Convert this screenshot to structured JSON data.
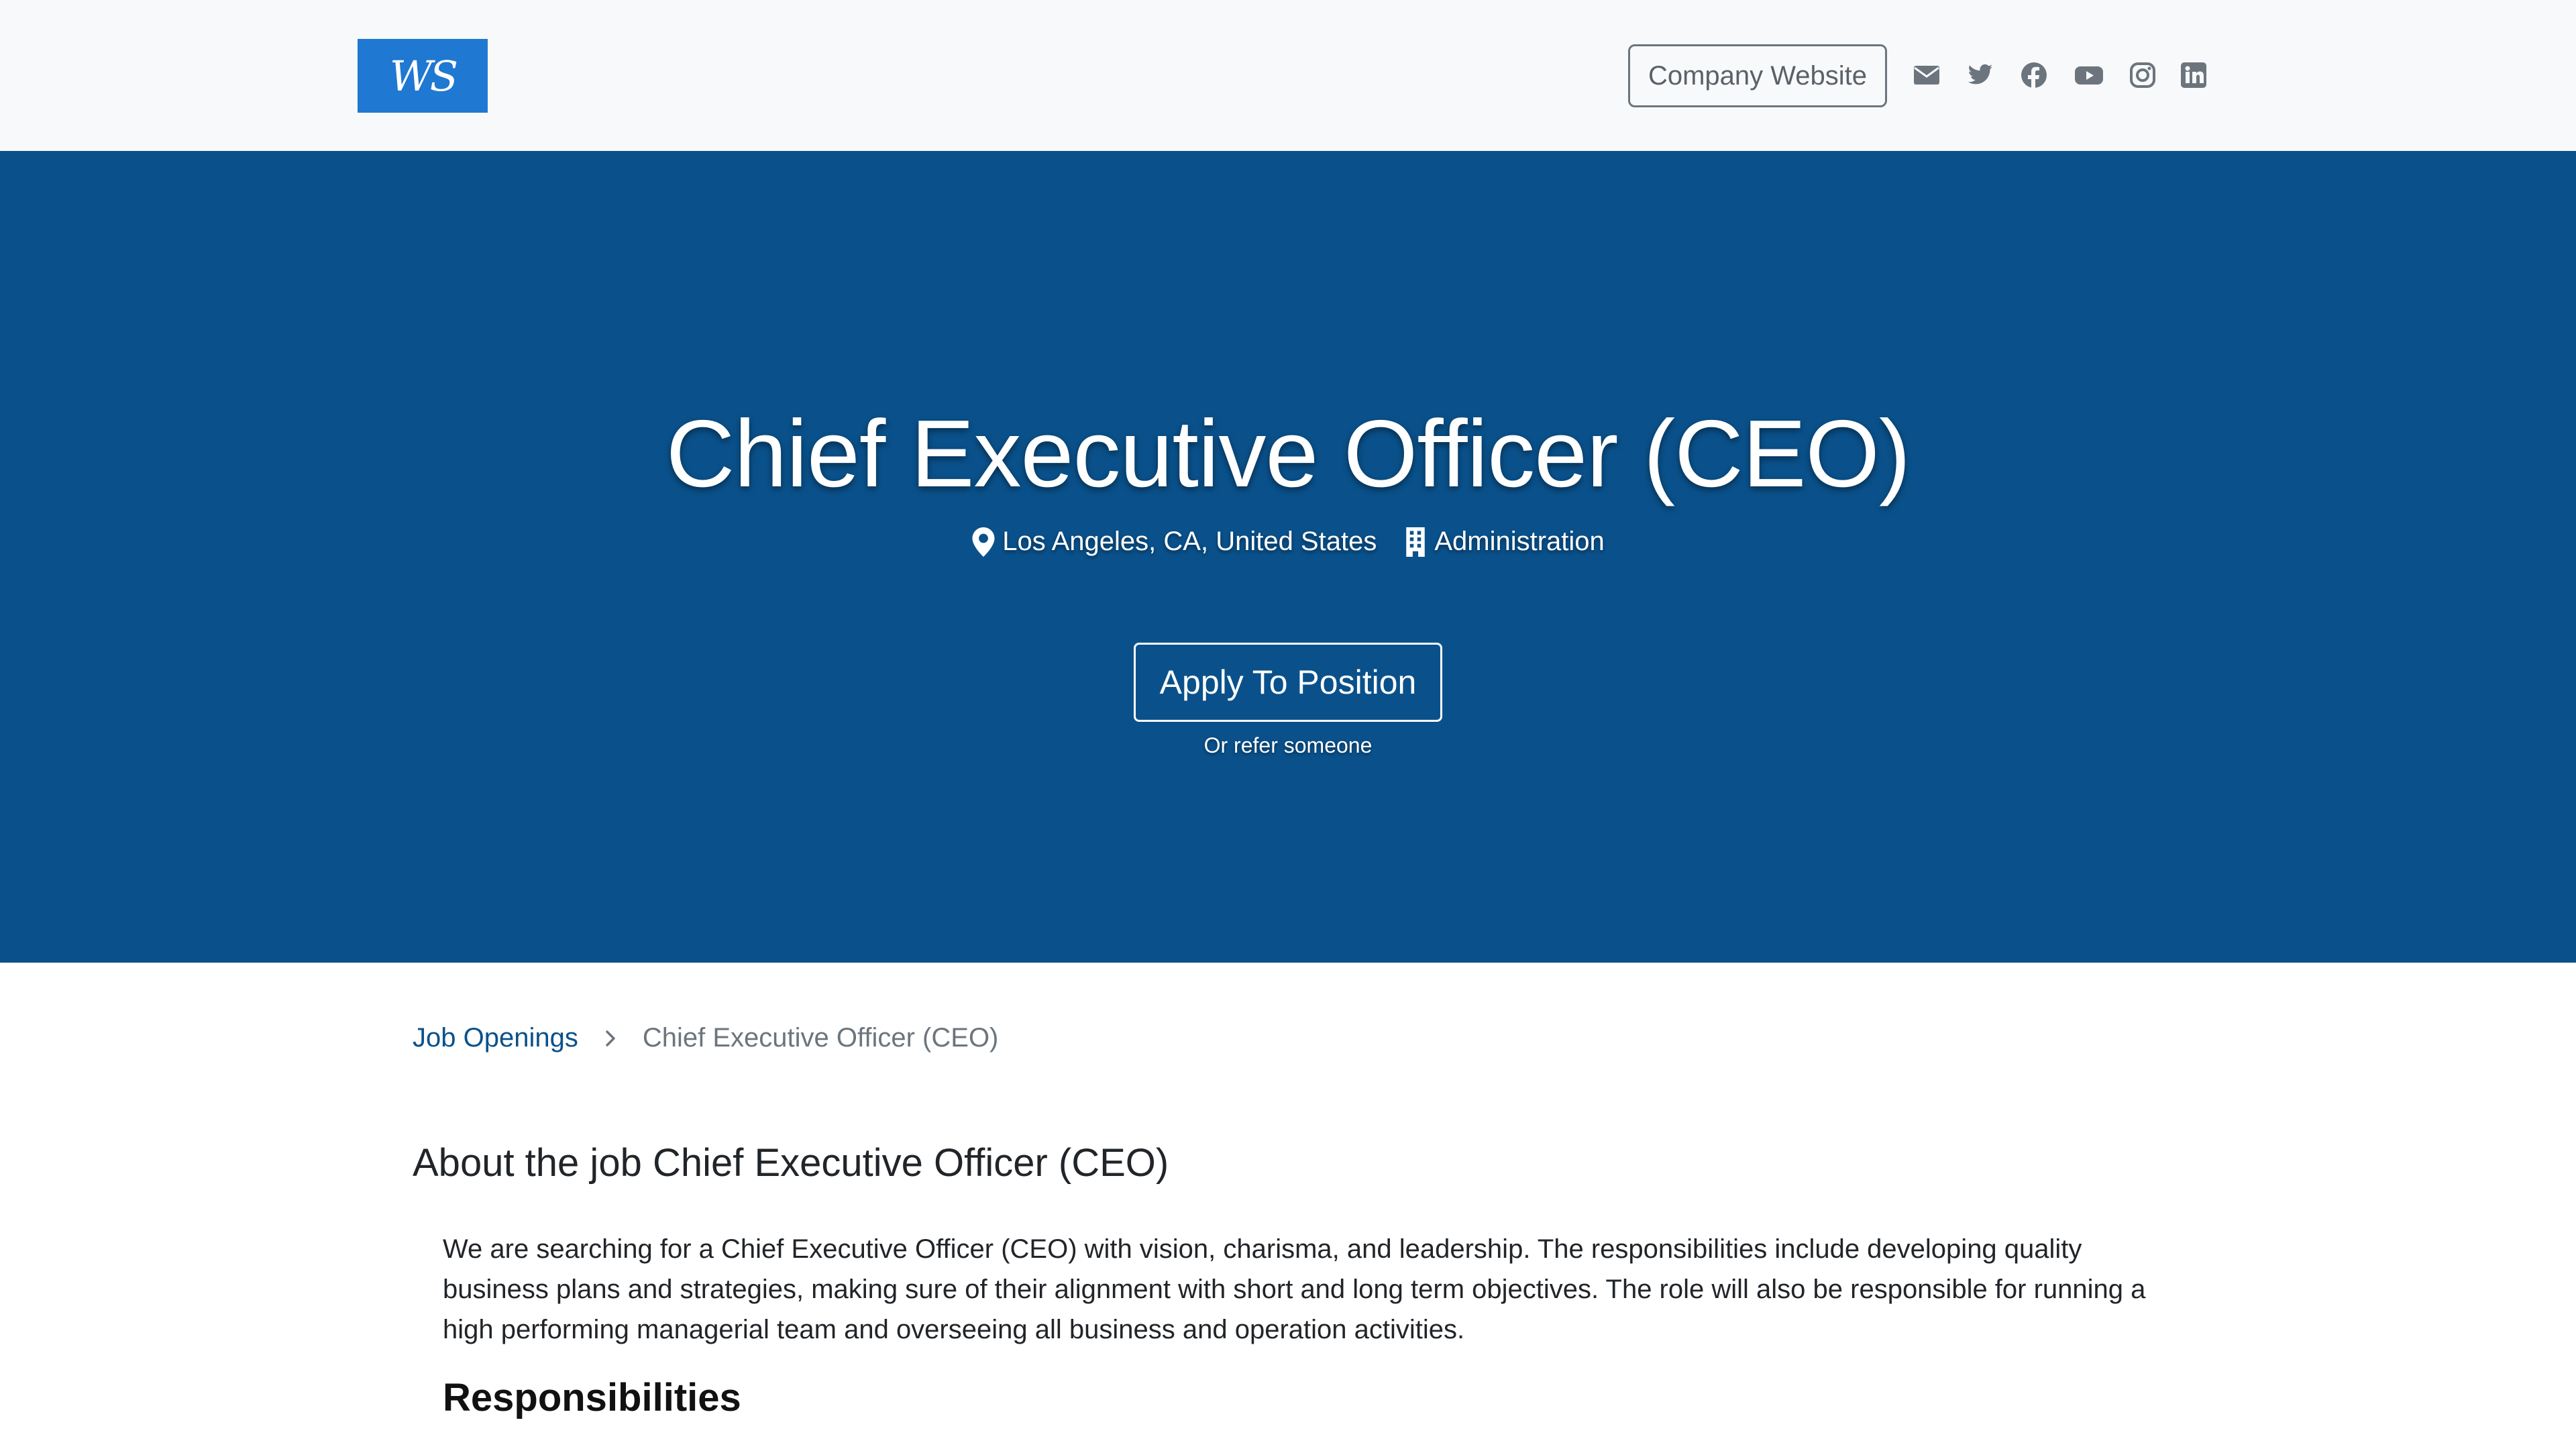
{
  "header": {
    "logo_text": "WS",
    "company_website_label": "Company Website",
    "social_icons": [
      "envelope-icon",
      "twitter-icon",
      "facebook-icon",
      "youtube-icon",
      "instagram-icon",
      "linkedin-icon"
    ]
  },
  "hero": {
    "title": "Chief Executive Officer (CEO)",
    "location": "Los Angeles, CA, United States",
    "department": "Administration",
    "apply_label": "Apply To Position",
    "refer_label": "Or refer someone",
    "background_color": "#0a518b"
  },
  "breadcrumb": {
    "parent": "Job Openings",
    "current": "Chief Executive Officer (CEO)"
  },
  "content": {
    "heading": "About the job Chief Executive Officer (CEO)",
    "description": "We are searching for a Chief Executive Officer (CEO) with vision, charisma, and leadership. The responsibilities include developing quality business plans and strategies, making sure of their alignment with short and long term objectives. The role will also be responsible for running a high performing managerial team and overseeing all business and operation activities.",
    "subheading": "Responsibilities"
  }
}
